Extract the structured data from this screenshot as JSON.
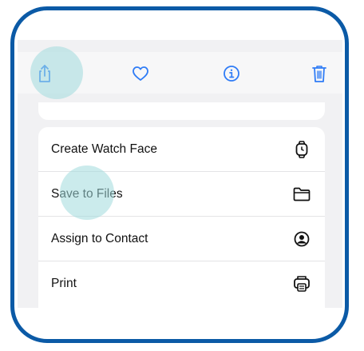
{
  "colors": {
    "frame_border": "#0b5aa6",
    "accent": "#2f7cf6",
    "tap_highlight": "#a0dadc"
  },
  "toolbar": {
    "items": [
      {
        "name": "share-icon"
      },
      {
        "name": "heart-icon"
      },
      {
        "name": "info-icon"
      },
      {
        "name": "trash-icon"
      }
    ]
  },
  "menu": {
    "items": [
      {
        "label": "Create Watch Face",
        "icon": "watch-icon"
      },
      {
        "label": "Save to Files",
        "icon": "folder-icon"
      },
      {
        "label": "Assign to Contact",
        "icon": "person-circle-icon"
      },
      {
        "label": "Print",
        "icon": "printer-icon"
      }
    ]
  }
}
